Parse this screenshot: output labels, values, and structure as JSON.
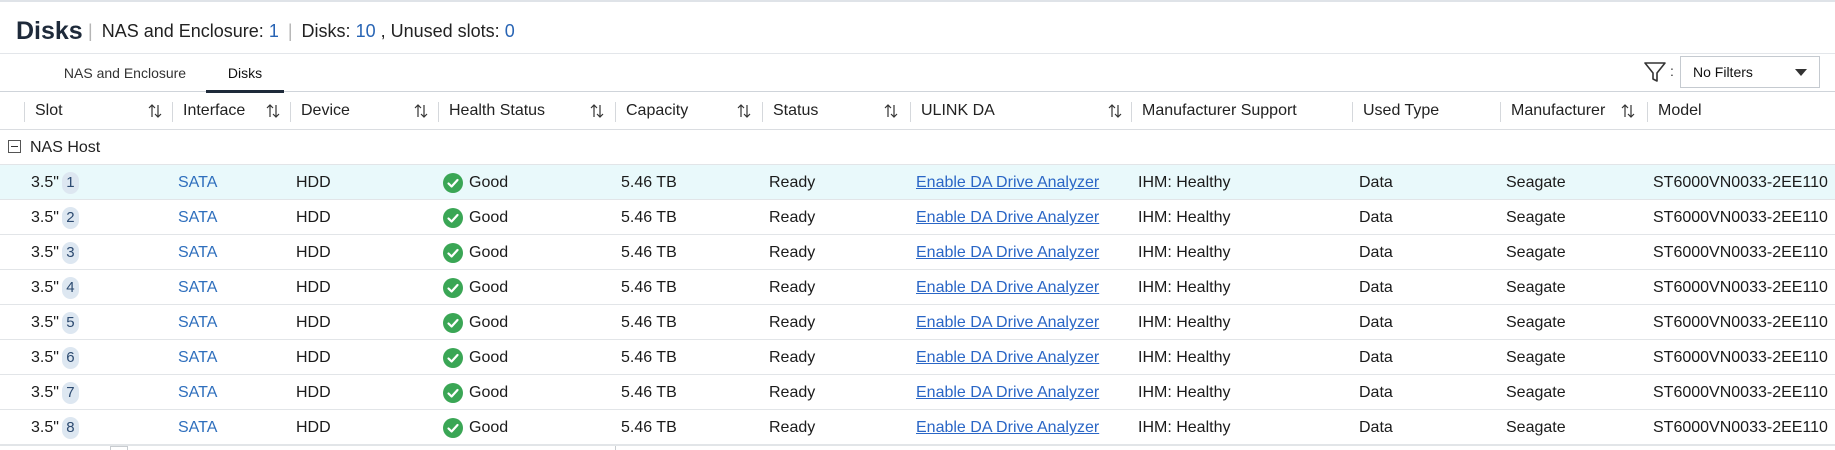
{
  "header": {
    "title": "Disks",
    "summary_label_nas": "NAS and Enclosure:",
    "summary_value_nas": "1",
    "summary_label_disks": "Disks:",
    "summary_value_disks": "10",
    "summary_label_unused": ", Unused slots:",
    "summary_value_unused": "0"
  },
  "tabs": [
    {
      "label": "NAS and Enclosure",
      "active": false
    },
    {
      "label": "Disks",
      "active": true
    }
  ],
  "filter": {
    "icon": "filter-icon",
    "colon": ":",
    "selected": "No Filters"
  },
  "columns": [
    {
      "label": "Slot",
      "sortable": true
    },
    {
      "label": "Interface",
      "sortable": true
    },
    {
      "label": "Device",
      "sortable": true
    },
    {
      "label": "Health Status",
      "sortable": true
    },
    {
      "label": "Capacity",
      "sortable": true
    },
    {
      "label": "Status",
      "sortable": true
    },
    {
      "label": "ULINK DA",
      "sortable": true
    },
    {
      "label": "Manufacturer Support",
      "sortable": false
    },
    {
      "label": "Used Type",
      "sortable": false
    },
    {
      "label": "Manufacturer",
      "sortable": true
    },
    {
      "label": "Model",
      "sortable": false
    }
  ],
  "group": {
    "label": "NAS Host"
  },
  "rows": [
    {
      "slot_size": "3.5\"",
      "slot_num": "1",
      "interface": "SATA",
      "device": "HDD",
      "health": "Good",
      "capacity": "5.46 TB",
      "status": "Ready",
      "ulink": "Enable DA Drive Analyzer",
      "support": "IHM: Healthy",
      "used_type": "Data",
      "manufacturer": "Seagate",
      "model": "ST6000VN0033-2EE110"
    },
    {
      "slot_size": "3.5\"",
      "slot_num": "2",
      "interface": "SATA",
      "device": "HDD",
      "health": "Good",
      "capacity": "5.46 TB",
      "status": "Ready",
      "ulink": "Enable DA Drive Analyzer",
      "support": "IHM: Healthy",
      "used_type": "Data",
      "manufacturer": "Seagate",
      "model": "ST6000VN0033-2EE110"
    },
    {
      "slot_size": "3.5\"",
      "slot_num": "3",
      "interface": "SATA",
      "device": "HDD",
      "health": "Good",
      "capacity": "5.46 TB",
      "status": "Ready",
      "ulink": "Enable DA Drive Analyzer",
      "support": "IHM: Healthy",
      "used_type": "Data",
      "manufacturer": "Seagate",
      "model": "ST6000VN0033-2EE110"
    },
    {
      "slot_size": "3.5\"",
      "slot_num": "4",
      "interface": "SATA",
      "device": "HDD",
      "health": "Good",
      "capacity": "5.46 TB",
      "status": "Ready",
      "ulink": "Enable DA Drive Analyzer",
      "support": "IHM: Healthy",
      "used_type": "Data",
      "manufacturer": "Seagate",
      "model": "ST6000VN0033-2EE110"
    },
    {
      "slot_size": "3.5\"",
      "slot_num": "5",
      "interface": "SATA",
      "device": "HDD",
      "health": "Good",
      "capacity": "5.46 TB",
      "status": "Ready",
      "ulink": "Enable DA Drive Analyzer",
      "support": "IHM: Healthy",
      "used_type": "Data",
      "manufacturer": "Seagate",
      "model": "ST6000VN0033-2EE110"
    },
    {
      "slot_size": "3.5\"",
      "slot_num": "6",
      "interface": "SATA",
      "device": "HDD",
      "health": "Good",
      "capacity": "5.46 TB",
      "status": "Ready",
      "ulink": "Enable DA Drive Analyzer",
      "support": "IHM: Healthy",
      "used_type": "Data",
      "manufacturer": "Seagate",
      "model": "ST6000VN0033-2EE110"
    },
    {
      "slot_size": "3.5\"",
      "slot_num": "7",
      "interface": "SATA",
      "device": "HDD",
      "health": "Good",
      "capacity": "5.46 TB",
      "status": "Ready",
      "ulink": "Enable DA Drive Analyzer",
      "support": "IHM: Healthy",
      "used_type": "Data",
      "manufacturer": "Seagate",
      "model": "ST6000VN0033-2EE110"
    },
    {
      "slot_size": "3.5\"",
      "slot_num": "8",
      "interface": "SATA",
      "device": "HDD",
      "health": "Good",
      "capacity": "5.46 TB",
      "status": "Ready",
      "ulink": "Enable DA Drive Analyzer",
      "support": "IHM: Healthy",
      "used_type": "Data",
      "manufacturer": "Seagate",
      "model": "ST6000VN0033-2EE110"
    }
  ],
  "colors": {
    "accent": "#1e2a3a",
    "link": "#2a66c6",
    "selected_row": "#e9f9fb",
    "good": "#3aa655"
  }
}
